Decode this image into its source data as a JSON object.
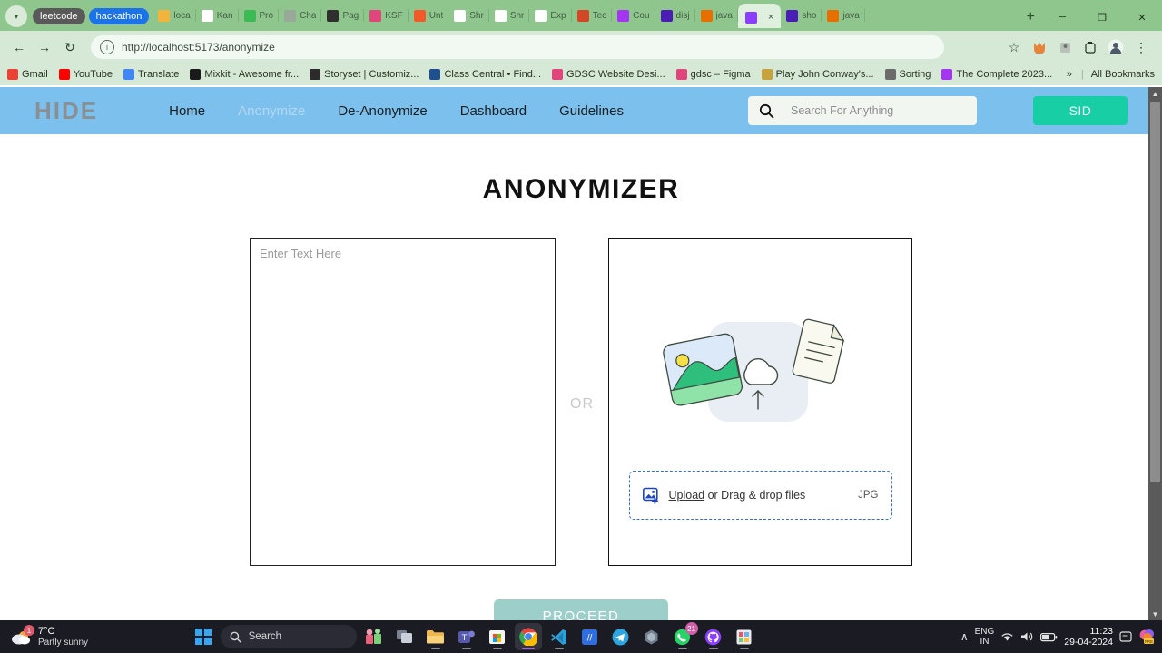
{
  "browser": {
    "tab_groups": [
      {
        "label": "leetcode",
        "color": "#595959"
      },
      {
        "label": "hackathon",
        "color": "#1a73e8"
      }
    ],
    "tabs": [
      {
        "label": "loca",
        "favicon": "maps-pin-icon",
        "color": "#f2b43a",
        "active": false
      },
      {
        "label": "Kan",
        "favicon": "spreadsheet-icon",
        "color": "#ffffff",
        "active": false
      },
      {
        "label": "Pro",
        "favicon": "google-drive-icon",
        "color": "#3cba54",
        "active": false
      },
      {
        "label": "Cha",
        "favicon": "chatgpt-icon",
        "color": "#9aa89a",
        "active": false
      },
      {
        "label": "Pag",
        "favicon": "play-icon",
        "color": "#2f2f2f",
        "active": false
      },
      {
        "label": "KSF",
        "favicon": "figma-icon",
        "color": "#e0457b",
        "active": false
      },
      {
        "label": "Unt",
        "favicon": "unity-icon",
        "color": "#f15a29",
        "active": false
      },
      {
        "label": "Shr",
        "favicon": "github-icon",
        "color": "#ffffff",
        "active": false
      },
      {
        "label": "Shr",
        "favicon": "github-icon",
        "color": "#ffffff",
        "active": false
      },
      {
        "label": "Exp",
        "favicon": "ex-icon",
        "color": "#ffffff",
        "active": false
      },
      {
        "label": "Tec",
        "favicon": "powerpoint-icon",
        "color": "#d24726",
        "active": false
      },
      {
        "label": "Cou",
        "favicon": "udemy-icon",
        "color": "#a435f0",
        "active": false
      },
      {
        "label": "disj",
        "favicon": "w3-icon",
        "color": "#4a1eb4",
        "active": false
      },
      {
        "label": "java",
        "favicon": "java-icon",
        "color": "#e76f00",
        "active": false
      },
      {
        "label": "",
        "favicon": "vite-icon",
        "color": "#8a3ffc",
        "active": true,
        "close": "×"
      },
      {
        "label": "sho",
        "favicon": "w3-icon",
        "color": "#4a1eb4",
        "active": false
      },
      {
        "label": "java",
        "favicon": "java-icon",
        "color": "#e76f00",
        "active": false
      }
    ],
    "new_tab_label": "+",
    "window_controls": [
      "─",
      "❐",
      "✕"
    ],
    "nav": {
      "back": "←",
      "forward": "→",
      "reload": "↻",
      "url": "http://localhost:5173/anonymize",
      "site_info_icon": "info-icon",
      "bookmark_star": "☆"
    },
    "toolbar_right_icons": [
      "extension-fox-icon",
      "extension-icon",
      "battery-extension-icon",
      "profile-avatar",
      "chrome-menu-icon"
    ],
    "bookmarks": [
      {
        "label": "Gmail",
        "icon": "gmail-icon",
        "color": "#ea4335"
      },
      {
        "label": "YouTube",
        "icon": "youtube-icon",
        "color": "#ff0000"
      },
      {
        "label": "Translate",
        "icon": "translate-icon",
        "color": "#4285f4"
      },
      {
        "label": "Mixkit - Awesome fr...",
        "icon": "mixkit-icon",
        "color": "#1a1a1a"
      },
      {
        "label": "Storyset | Customiz...",
        "icon": "storyset-icon",
        "color": "#2b2b2b"
      },
      {
        "label": "Class Central • Find...",
        "icon": "classcentral-icon",
        "color": "#1f4f8f"
      },
      {
        "label": "GDSC Website Desi...",
        "icon": "figma-icon",
        "color": "#e0457b"
      },
      {
        "label": "gdsc – Figma",
        "icon": "figma-icon",
        "color": "#e0457b"
      },
      {
        "label": "Play John Conway's...",
        "icon": "game-icon",
        "color": "#c8a23c"
      },
      {
        "label": "Sorting",
        "icon": "sorting-icon",
        "color": "#6b6b6b"
      },
      {
        "label": "The Complete 2023...",
        "icon": "udemy-icon",
        "color": "#a435f0"
      }
    ],
    "bookmarks_overflow": "»",
    "all_bookmarks_label": "All Bookmarks",
    "all_bookmarks_icon": "folder-icon"
  },
  "site": {
    "navbar": {
      "logo": "HIDE",
      "links": [
        {
          "label": "Home",
          "muted": false
        },
        {
          "label": "Anonymize",
          "muted": true
        },
        {
          "label": "De-Anonymize",
          "muted": false
        },
        {
          "label": "Dashboard",
          "muted": false
        },
        {
          "label": "Guidelines",
          "muted": false
        }
      ],
      "search_placeholder": "Search For Anything",
      "search_value": "",
      "account_label": "SID",
      "bg_color": "#7cc0ee",
      "accent_color": "#18cfa5"
    },
    "page_title": "ANONYMIZER",
    "text_panel": {
      "placeholder": "Enter Text Here",
      "value": ""
    },
    "divider_label": "OR",
    "upload_panel": {
      "upload_link": "Upload",
      "upload_rest": " or Drag & drop files",
      "file_type": "JPG",
      "upload_icon": "image-add-icon",
      "illustration": "image-cloud-document-illustration"
    },
    "proceed_label": "PROCEED",
    "proceed_color": "#9ccfc9"
  },
  "taskbar": {
    "weather": {
      "temp": "7°C",
      "desc": "Partly sunny",
      "badge": "1",
      "icon": "weather-partly-sunny-icon"
    },
    "start_icon": "windows-start-icon",
    "search_label": "Search",
    "search_icon": "search-icon",
    "apps": [
      {
        "name": "widgets-gift-icon",
        "badge": "",
        "active": false,
        "running": false
      },
      {
        "name": "task-view-icon",
        "badge": "",
        "active": false,
        "running": false
      },
      {
        "name": "file-explorer-icon",
        "badge": "",
        "active": false,
        "running": true
      },
      {
        "name": "microsoft-teams-icon",
        "badge": "",
        "active": false,
        "running": true
      },
      {
        "name": "microsoft-store-icon",
        "badge": "",
        "active": false,
        "running": true
      },
      {
        "name": "google-chrome-icon",
        "badge": "",
        "active": true,
        "running": true
      },
      {
        "name": "vs-code-icon",
        "badge": "",
        "active": false,
        "running": true
      },
      {
        "name": "blue-app-icon",
        "badge": "",
        "active": false,
        "running": false
      },
      {
        "name": "telegram-icon",
        "badge": "",
        "active": false,
        "running": false
      },
      {
        "name": "copilot-icon",
        "badge": "",
        "active": false,
        "running": false
      },
      {
        "name": "whatsapp-icon",
        "badge": "21",
        "active": false,
        "running": true
      },
      {
        "name": "github-desktop-icon",
        "badge": "",
        "active": false,
        "running": true
      },
      {
        "name": "snipping-tool-icon",
        "badge": "",
        "active": false,
        "running": true
      }
    ],
    "tray": {
      "chevron": "∧",
      "language_top": "ENG",
      "language_bottom": "IN",
      "wifi_icon": "wifi-icon",
      "volume_icon": "volume-icon",
      "battery_icon": "battery-icon",
      "time": "11:23",
      "date": "29-04-2024",
      "notification_icon": "notification-icon",
      "tray_app": "PRE"
    }
  }
}
